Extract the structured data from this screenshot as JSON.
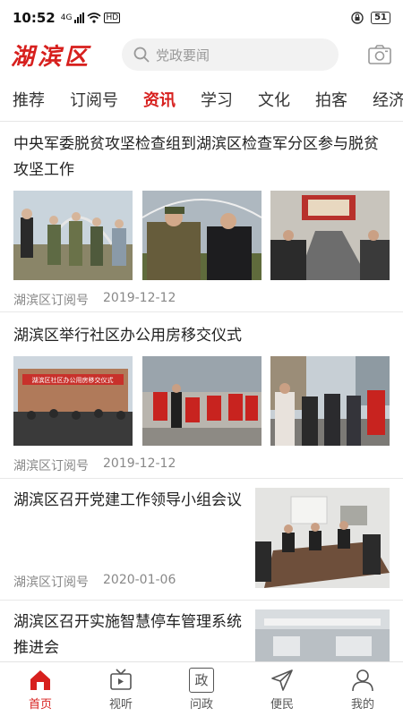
{
  "status_bar": {
    "time": "10:52",
    "network": "4G",
    "hd": "HD",
    "battery": "51"
  },
  "header": {
    "logo": "湖滨区",
    "search_placeholder": "党政要闻"
  },
  "tabs": [
    {
      "label": "推荐"
    },
    {
      "label": "订阅号"
    },
    {
      "label": "资讯",
      "active": true
    },
    {
      "label": "学习"
    },
    {
      "label": "文化"
    },
    {
      "label": "拍客"
    },
    {
      "label": "经济"
    }
  ],
  "articles": [
    {
      "title": "中央军委脱贫攻坚检查组到湖滨区检查军分区参与脱贫攻坚工作",
      "source": "湖滨区订阅号",
      "date": "2019-12-12"
    },
    {
      "title": "湖滨区举行社区办公用房移交仪式",
      "source": "湖滨区订阅号",
      "date": "2019-12-12",
      "banner_text": "湖滨区社区办公用房移交仪式"
    },
    {
      "title": "湖滨区召开党建工作领导小组会议",
      "source": "湖滨区订阅号",
      "date": "2020-01-06"
    },
    {
      "title": "湖滨区召开实施智慧停车管理系统推进会"
    }
  ],
  "bottom_nav": [
    {
      "label": "首页",
      "icon": "home-icon",
      "active": true
    },
    {
      "label": "视听",
      "icon": "tv-icon"
    },
    {
      "label": "问政",
      "icon": "politics-icon",
      "glyph": "政"
    },
    {
      "label": "便民",
      "icon": "send-icon"
    },
    {
      "label": "我的",
      "icon": "user-icon"
    }
  ],
  "colors": {
    "accent": "#d7201e",
    "text": "#222222",
    "meta": "#888888"
  }
}
